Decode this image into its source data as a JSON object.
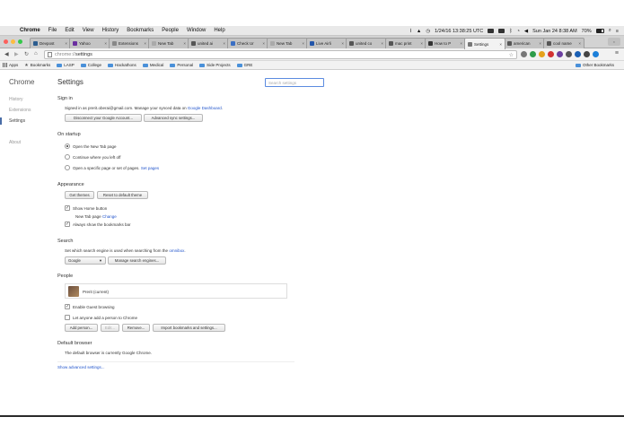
{
  "menubar": {
    "items": [
      "Chrome",
      "File",
      "Edit",
      "View",
      "History",
      "Bookmarks",
      "People",
      "Window",
      "Help"
    ],
    "datetime": "1/24/16 13:38:25 UTC",
    "clock": "Sun Jan 24  8:38 AM",
    "battery": "70%"
  },
  "tabs": [
    {
      "label": "Devpost",
      "color": "#2c5d8f"
    },
    {
      "label": "Yahoo",
      "color": "#6b2fa0"
    },
    {
      "label": "Extensions",
      "color": "#888888"
    },
    {
      "label": "New Tab",
      "color": "#aaaaaa"
    },
    {
      "label": "united ai",
      "color": "#555555"
    },
    {
      "label": "Check Ur",
      "color": "#3a6fc4"
    },
    {
      "label": "New Tab",
      "color": "#aaaaaa"
    },
    {
      "label": "Live Airli",
      "color": "#2255aa"
    },
    {
      "label": "united co",
      "color": "#555555"
    },
    {
      "label": "mac print",
      "color": "#555555"
    },
    {
      "label": "How to P",
      "color": "#333333"
    },
    {
      "label": "Settings",
      "color": "#777777"
    },
    {
      "label": "american",
      "color": "#555555"
    },
    {
      "label": "cool name",
      "color": "#555555"
    }
  ],
  "omnibox": {
    "scheme": "chrome://",
    "path": "settings"
  },
  "bookmarks": {
    "apps": "Apps",
    "bookmarks": "Bookmarks",
    "folders": [
      "LASP",
      "College",
      "Hackathons",
      "Medical",
      "Personal",
      "Side Projects",
      "GRE"
    ],
    "other": "Other Bookmarks"
  },
  "nav": {
    "title": "Chrome",
    "items": [
      "History",
      "Extensions",
      "Settings"
    ],
    "about": "About"
  },
  "page": {
    "title": "Settings",
    "search_placeholder": "Search settings"
  },
  "signin": {
    "title": "Sign in",
    "text": "Signed in as prerit.oberai@gmail.com. Manage your synced data on",
    "link": "Google Dashboard",
    "period": ".",
    "disconnect": "Disconnect your Google Account...",
    "advanced_sync": "Advanced sync settings..."
  },
  "startup": {
    "title": "On startup",
    "options": [
      "Open the New Tab page",
      "Continue where you left off",
      "Open a specific page or set of pages."
    ],
    "set_pages": "Set pages"
  },
  "appearance": {
    "title": "Appearance",
    "get_themes": "Get themes",
    "reset_theme": "Reset to default theme",
    "show_home": "Show Home button",
    "new_tab_page": "New Tab page",
    "change": "Change",
    "show_bookmarks": "Always show the bookmarks bar"
  },
  "search_section": {
    "title": "Search",
    "text": "Set which search engine is used when searching from the",
    "link": "omnibox",
    "period": ".",
    "engine": "Google",
    "manage": "Manage search engines..."
  },
  "people": {
    "title": "People",
    "current": "Prerit (current)",
    "guest": "Enable Guest browsing",
    "anyone": "Let anyone add a person to Chrome",
    "add": "Add person...",
    "edit": "Edit...",
    "remove": "Remove...",
    "import": "Import bookmarks and settings..."
  },
  "default_browser": {
    "title": "Default browser",
    "text": "The default browser is currently Google Chrome."
  },
  "advanced_link": "Show advanced settings...",
  "colors": {
    "accent": "#4a6da7",
    "link": "#2255cc",
    "folder": "#4a90d9"
  }
}
